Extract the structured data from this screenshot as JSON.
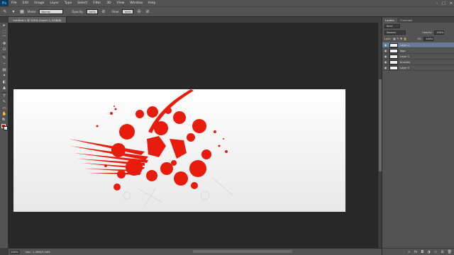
{
  "app": {
    "logo": "Ps"
  },
  "menu": [
    "File",
    "Edit",
    "Image",
    "Layer",
    "Type",
    "Select",
    "Filter",
    "3D",
    "View",
    "Window",
    "Help"
  ],
  "window_controls": [
    "–",
    "□",
    "✕"
  ],
  "options": {
    "mode_label": "Mode:",
    "mode_value": "Normal",
    "opacity_label": "Opacity:",
    "opacity_value": "100%",
    "flow_label": "Flow:",
    "flow_value": "100%"
  },
  "document": {
    "tab_title": "Untitled-1 @ 100% (Layer 2, RGB/8)"
  },
  "tools": [
    "▸",
    "⬚",
    "⌒",
    "✥",
    "⊡",
    "✎",
    "⌁",
    "▤",
    "✦",
    "◐",
    "▲",
    "T",
    "↖",
    "▭",
    "✋",
    "🔍"
  ],
  "status": {
    "zoom": "100%",
    "doc": "Doc: 1.49M/3.04M"
  },
  "panel": {
    "tabs": [
      "Layers",
      "Channels"
    ],
    "kind_label": "Kind",
    "blend_mode": "Normal",
    "opacity_label": "Opacity:",
    "opacity_value": "100%",
    "lock_label": "Lock:",
    "fill_label": "Fill:",
    "fill_value": "100%"
  },
  "layers": [
    {
      "name": "Layer 2",
      "selected": true
    },
    {
      "name": "logo",
      "selected": false
    },
    {
      "name": "Layer 1",
      "selected": false
    },
    {
      "name": "brushes",
      "selected": false
    },
    {
      "name": "Layer 0",
      "selected": false
    }
  ],
  "colors": {
    "foreground": "#d40000",
    "background": "#ffffff",
    "accent": "#e01a0a"
  }
}
